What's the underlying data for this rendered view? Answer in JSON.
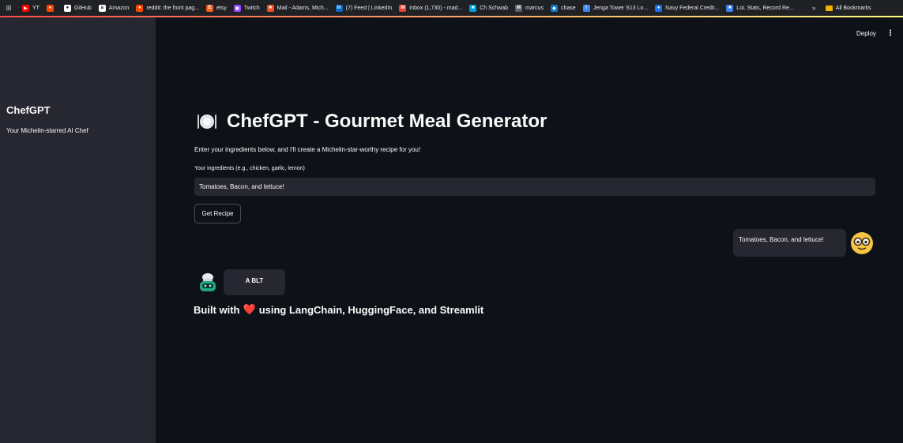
{
  "bookmarks": [
    {
      "label": "YT",
      "icon": "youtube-icon",
      "color": "#ff0000",
      "glyph": "▶"
    },
    {
      "label": "",
      "icon": "reddit-icon",
      "color": "#ff4500",
      "glyph": "●"
    },
    {
      "label": "GitHub",
      "icon": "github-icon",
      "color": "#ffffff",
      "glyph": "●"
    },
    {
      "label": "Amazon",
      "icon": "amazon-icon",
      "color": "#ffffff",
      "glyph": "a"
    },
    {
      "label": "reddit: the front pag...",
      "icon": "reddit-icon",
      "color": "#ff4500",
      "glyph": "●"
    },
    {
      "label": "etsy",
      "icon": "etsy-icon",
      "color": "#f1641e",
      "glyph": "E"
    },
    {
      "label": "Twitch",
      "icon": "twitch-icon",
      "color": "#9146ff",
      "glyph": "▣"
    },
    {
      "label": "Mail - Adams, Mich...",
      "icon": "microsoft-icon",
      "color": "#f25022",
      "glyph": "■"
    },
    {
      "label": "(7) Feed | LinkedIn",
      "icon": "linkedin-icon",
      "color": "#0a66c2",
      "glyph": "in"
    },
    {
      "label": "Inbox (1,730) - mad...",
      "icon": "gmail-icon",
      "color": "#ea4335",
      "glyph": "M"
    },
    {
      "label": "Ch Schwab",
      "icon": "schwab-icon",
      "color": "#00a0df",
      "glyph": "■"
    },
    {
      "label": "marcus",
      "icon": "marcus-icon",
      "color": "#5f6368",
      "glyph": "M"
    },
    {
      "label": "chase",
      "icon": "chase-icon",
      "color": "#117aca",
      "glyph": "◆"
    },
    {
      "label": "Jenga Tower S13 Lo...",
      "icon": "jenga-icon",
      "color": "#4285f4",
      "glyph": "I"
    },
    {
      "label": "Navy Federal Credit...",
      "icon": "navy-federal-icon",
      "color": "#1a73e8",
      "glyph": "●"
    },
    {
      "label": "LoL Stats, Record Re...",
      "icon": "lol-stats-icon",
      "color": "#3b82f6",
      "glyph": "■"
    }
  ],
  "bookmarks_more": "»",
  "all_bookmarks": "All Bookmarks",
  "sidebar": {
    "title": "ChefGPT",
    "subtitle": "Your Michelin-starred AI Chef"
  },
  "header": {
    "deploy": "Deploy",
    "menu": "⋮"
  },
  "main": {
    "title": "ChefGPT - Gourmet Meal Generator",
    "intro": "Enter your ingredients below, and I'll create a Michelin-star-worthy recipe for you!",
    "input_label": "Your ingredients (e.g., chicken, garlic, lemon)",
    "input_value": "Tomatoes, Bacon, and lettuce!",
    "button_label": "Get Recipe"
  },
  "chat": {
    "user_message": "Tomatoes, Bacon, and lettuce!",
    "bot_message": "A BLT"
  },
  "footer": {
    "prefix": "Built with",
    "heart": "❤️",
    "suffix": "using LangChain, HuggingFace, and Streamlit"
  },
  "colors": {
    "background": "#0e1117",
    "sidebar": "#262730",
    "accent_red": "#ff4b4b"
  }
}
